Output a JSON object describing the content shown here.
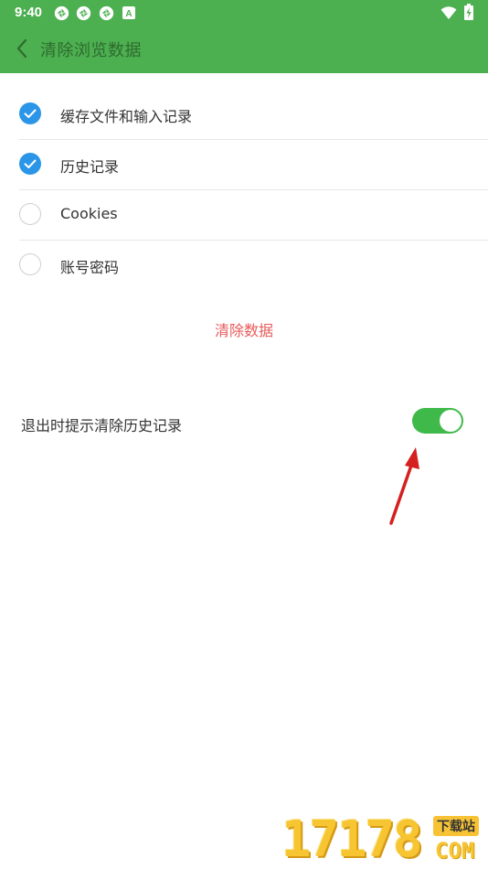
{
  "status_bar": {
    "time": "9:40",
    "notification_icons": [
      "sync-icon",
      "sync-icon",
      "sync-icon",
      "a-icon"
    ],
    "a_icon_letter": "A",
    "wifi": "wifi-icon",
    "battery": "battery-charging-icon"
  },
  "toolbar": {
    "title": "清除浏览数据",
    "back_icon": "chevron-left-icon"
  },
  "options": [
    {
      "label": "缓存文件和输入记录",
      "checked": true
    },
    {
      "label": "历史记录",
      "checked": true
    },
    {
      "label": "Cookies",
      "checked": false
    },
    {
      "label": "账号密码",
      "checked": false
    }
  ],
  "clear_button": {
    "label": "清除数据"
  },
  "exit_prompt": {
    "label": "退出时提示清除历史记录",
    "enabled": true
  },
  "watermark": {
    "digits": "17178",
    "badge": "下载站",
    "suffix": "COM"
  },
  "colors": {
    "toolbar": "#4CAF50",
    "checkbox_checked": "#2b95e8",
    "clear_button": "#e85a5a",
    "switch_on": "#3fba4a",
    "annotation_arrow": "#d42020",
    "watermark": "#f6c531"
  }
}
